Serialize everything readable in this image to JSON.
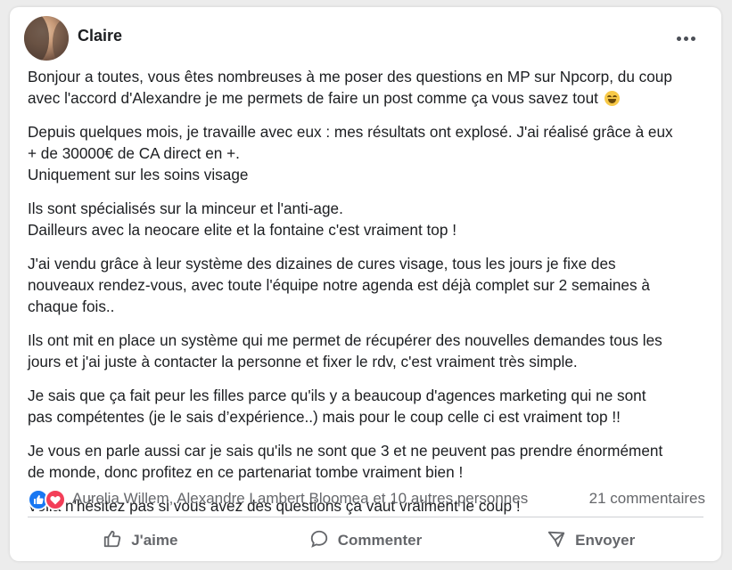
{
  "post": {
    "author": "Claire",
    "paragraphs": [
      "Bonjour a toutes, vous êtes nombreuses à me poser des questions en MP sur Npcorp, du coup\navec l'accord d'Alexandre je me permets de faire un post comme ça vous savez tout",
      "Depuis quelques mois, je travaille avec eux : mes résultats ont explosé. J'ai réalisé grâce à eux\n+ de 30000€ de CA direct en +.\nUniquement sur les soins visage",
      "Ils sont spécialisés sur la minceur et l'anti-age.\nDailleurs avec la neocare elite et la fontaine c'est vraiment top !",
      "J'ai vendu grâce à leur système des dizaines de cures visage, tous les jours je fixe des\nnouveaux rendez-vous, avec toute l'équipe notre agenda est déjà complet sur 2 semaines à\nchaque fois..",
      "Ils ont mit en place un système qui me permet de récupérer des nouvelles demandes tous les\njours et j'ai juste à contacter la personne et fixer le rdv, c'est vraiment très simple.",
      "Je sais que ça fait peur les filles parce qu'ils y a beaucoup d'agences marketing qui ne sont\npas compétentes (je le sais d’expérience..) mais pour le coup celle ci est vraiment top !!",
      "Je vous en parle aussi car je sais qu'ils ne sont que 3 et ne peuvent pas prendre énormément\nde monde, donc profitez en ce partenariat tombe vraiment bien !",
      "Voilà n'hésitez pas si vous avez des questions ça vaut vraiment le coup !"
    ],
    "emoji": "grinning-face-with-smiling-eyes"
  },
  "reactions": {
    "icons": [
      "like-icon",
      "love-icon"
    ],
    "names": "Aurelia Willem, Alexandre Lambert Bloomea et 10 autres personnes",
    "comments": "21 commentaires"
  },
  "actions": {
    "like": "J'aime",
    "comment": "Commenter",
    "share": "Envoyer"
  },
  "colors": {
    "like_blue": "#1877f2",
    "love_red": "#f33e58",
    "secondary_text": "#65676b"
  }
}
